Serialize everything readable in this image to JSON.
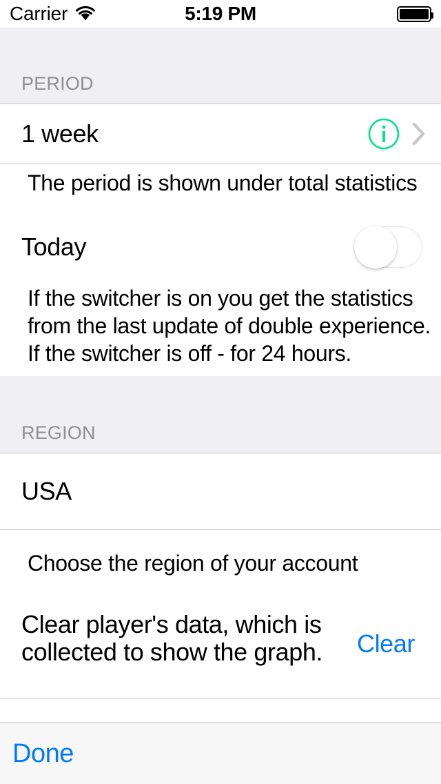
{
  "status_bar": {
    "carrier": "Carrier",
    "wifi_icon": "wifi-icon",
    "time": "5:19 PM",
    "battery_icon": "battery-full-icon"
  },
  "sections": {
    "period": {
      "header": "PERIOD",
      "row": {
        "title": "1 week",
        "info_icon": "info-circle-icon",
        "chevron_icon": "chevron-right-icon",
        "accent_color": "#00E58C"
      },
      "footer": "The period is shown under total statistics",
      "toggle_row": {
        "label": "Today",
        "state": "off"
      },
      "toggle_footer_line1": "If the switcher is on you get the statistics",
      "toggle_footer_line2": "from the last update of double experience.",
      "toggle_footer_line3": "If the switcher is off - for 24 hours."
    },
    "region": {
      "header": "REGION",
      "row": {
        "title": "USA"
      },
      "footer": "Choose the region of your account",
      "clear_row": {
        "line1": "Clear player's data, which is",
        "line2": "collected to show the graph.",
        "button_label": "Clear",
        "button_color": "#007AFF"
      }
    }
  },
  "toolbar": {
    "done_label": "Done",
    "done_color": "#007AFF"
  }
}
